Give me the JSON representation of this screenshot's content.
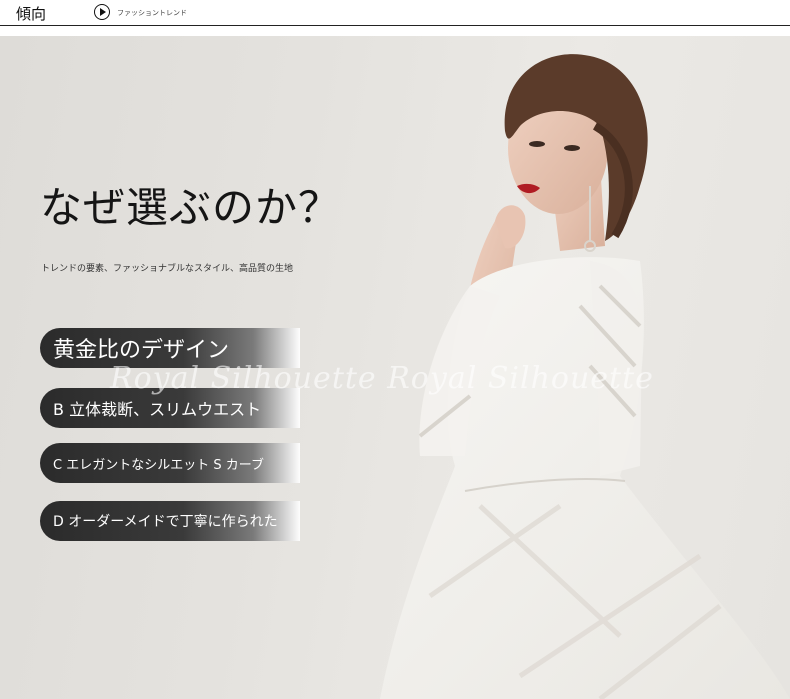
{
  "header": {
    "title": "傾向",
    "subtitle": "ファッショントレンド",
    "arrow_icon": "play-circle-icon"
  },
  "hero": {
    "headline": "なぜ選ぶのか？",
    "subline": "トレンドの要素、ファッショナブルなスタイル、高品質の生地",
    "features": [
      "黄金比のデザイン",
      "B 立体裁断、スリムウエスト",
      "C エレガントなシルエット S カーブ",
      "D オーダーメイドで丁寧に作られた"
    ],
    "watermark": "Royal Silhouette Royal Silhouette"
  }
}
